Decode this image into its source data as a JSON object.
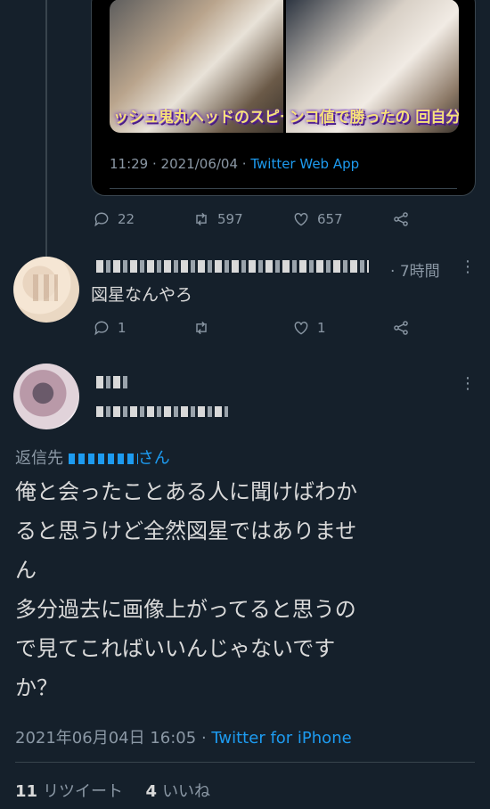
{
  "quoted_tweet": {
    "caption_left": "ッシュ鬼丸ヘッドのスピー をアタック!",
    "caption_right": "ンコ値で勝ったの 回自分のターン来",
    "time": "11:29",
    "date": "2021/06/04",
    "source": "Twitter Web App"
  },
  "parent_actions": {
    "replies": "22",
    "retweets": "597",
    "likes": "657"
  },
  "reply": {
    "time_ago": "7時間",
    "text": "図星なんやろ",
    "replies": "1",
    "likes": "1"
  },
  "main_tweet": {
    "reply_to_prefix": "返信先",
    "reply_to_suffix": "さん",
    "lines": [
      "俺と会ったことある人に聞けばわか",
      "ると思うけど全然図星ではありませ",
      "ん",
      "多分過去に画像上がってると思うの",
      "で見てこればいいんじゃないです",
      "か？"
    ],
    "timestamp": "2021年06月04日 16:05",
    "source": "Twitter for iPhone",
    "retweet_count": "11",
    "retweet_label": "リツイート",
    "like_count": "4",
    "like_label": "いいね"
  },
  "colors": {
    "background": "#15202b",
    "accent": "#1d9bf0",
    "muted": "#8b98a5"
  }
}
